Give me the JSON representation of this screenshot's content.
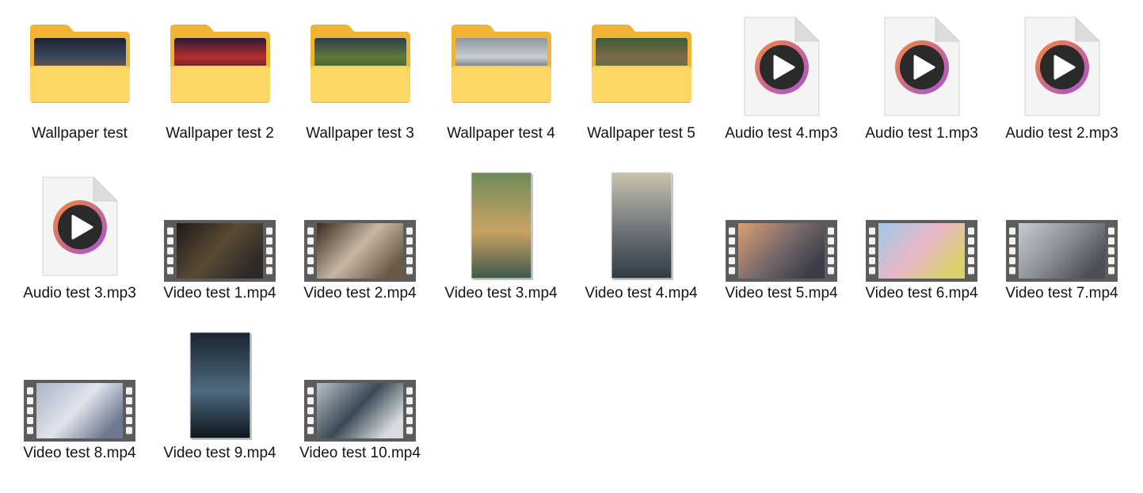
{
  "colors": {
    "folder_back": "#f0b432",
    "folder_front": "#fdd765",
    "folder_front_edge": "#f6c645",
    "doc_page": "#f4f4f4",
    "doc_fold": "#dcdcdc",
    "play_ring_start": "#f28a3a",
    "play_ring_end": "#a64fd8",
    "play_disc": "#2a2a2a",
    "film_frame": "#5c5c5c",
    "film_hole": "#f2f2f2"
  },
  "items": [
    {
      "name": "Wallpaper test",
      "kind": "folder",
      "icon": "folder-icon",
      "thumb": [
        "#1c2030",
        "#39495e",
        "#8a5b2a"
      ]
    },
    {
      "name": "Wallpaper test 2",
      "kind": "folder",
      "icon": "folder-icon",
      "thumb": [
        "#2a1a3a",
        "#b82d2d",
        "#3b1e28"
      ]
    },
    {
      "name": "Wallpaper test 3",
      "kind": "folder",
      "icon": "folder-icon",
      "thumb": [
        "#2f3e4e",
        "#5e7a3a",
        "#3d5a36"
      ]
    },
    {
      "name": "Wallpaper test 4",
      "kind": "folder",
      "icon": "folder-icon",
      "thumb": [
        "#8e969c",
        "#c9ced2",
        "#3c4a42"
      ]
    },
    {
      "name": "Wallpaper test 5",
      "kind": "folder",
      "icon": "folder-icon",
      "thumb": [
        "#3f5b35",
        "#7b6a4a",
        "#5a6f3a"
      ]
    },
    {
      "name": "Audio test 4.mp3",
      "kind": "audio",
      "icon": "audio-file-icon"
    },
    {
      "name": "Audio test 1.mp3",
      "kind": "audio",
      "icon": "audio-file-icon"
    },
    {
      "name": "Audio test 2.mp3",
      "kind": "audio",
      "icon": "audio-file-icon"
    },
    {
      "name": "Audio test 3.mp3",
      "kind": "audio",
      "icon": "audio-file-icon"
    },
    {
      "name": "Video test 1.mp4",
      "kind": "video",
      "icon": "video-file-icon",
      "orientation": "landscape",
      "thumb": [
        "#1e1a18",
        "#5a4a34",
        "#2e2a28"
      ]
    },
    {
      "name": "Video test 2.mp4",
      "kind": "video",
      "icon": "video-file-icon",
      "orientation": "landscape",
      "thumb": [
        "#3a2a20",
        "#c7b7a4",
        "#6b5a48"
      ]
    },
    {
      "name": "Video test 3.mp4",
      "kind": "video",
      "icon": "video-file-icon",
      "orientation": "portrait",
      "thumb": [
        "#6e8a5a",
        "#c9a262",
        "#3e5a4a"
      ]
    },
    {
      "name": "Video test 4.mp4",
      "kind": "video",
      "icon": "video-file-icon",
      "orientation": "portrait",
      "thumb": [
        "#c9c2ad",
        "#6e7479",
        "#2e3a44"
      ]
    },
    {
      "name": "Video test 5.mp4",
      "kind": "video",
      "icon": "video-file-icon",
      "orientation": "landscape",
      "thumb": [
        "#d9a074",
        "#7a6a6a",
        "#3a3e4a"
      ]
    },
    {
      "name": "Video test 6.mp4",
      "kind": "video",
      "icon": "video-file-icon",
      "orientation": "landscape",
      "thumb": [
        "#9ec8e8",
        "#e8b8c8",
        "#d8d068"
      ]
    },
    {
      "name": "Video test 7.mp4",
      "kind": "video",
      "icon": "video-file-icon",
      "orientation": "landscape",
      "thumb": [
        "#c8ccd2",
        "#8a8f96",
        "#4a5056"
      ]
    },
    {
      "name": "Video test 8.mp4",
      "kind": "video",
      "icon": "video-file-icon",
      "orientation": "landscape",
      "thumb": [
        "#aab4c4",
        "#e0e4ec",
        "#6e7890"
      ]
    },
    {
      "name": "Video test 9.mp4",
      "kind": "video",
      "icon": "video-file-icon",
      "orientation": "portrait",
      "thumb": [
        "#1a2430",
        "#4e6a7e",
        "#0e161e"
      ]
    },
    {
      "name": "Video test 10.mp4",
      "kind": "video",
      "icon": "video-file-icon",
      "orientation": "landscape",
      "thumb": [
        "#b8c0c8",
        "#3a4a54",
        "#d8dce0"
      ]
    }
  ]
}
